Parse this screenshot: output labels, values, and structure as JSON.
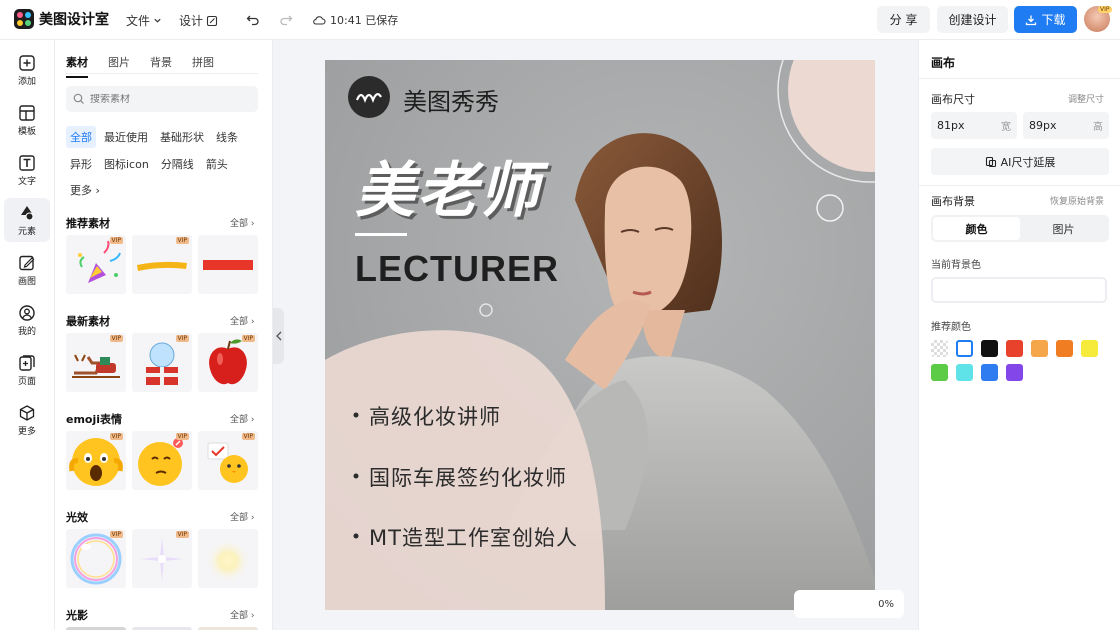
{
  "app": {
    "name": "美图设计室"
  },
  "topbar": {
    "menu_file": "文件",
    "menu_design": "设计",
    "saved_status": "10:41 已保存",
    "share_label": "分 享",
    "create_label": "创建设计",
    "download_label": "下载",
    "avatar_badge": "VIP"
  },
  "leftnav": {
    "items": [
      {
        "label": "添加",
        "icon": "plus-square-icon"
      },
      {
        "label": "模板",
        "icon": "template-icon"
      },
      {
        "label": "文字",
        "icon": "text-icon"
      },
      {
        "label": "元素",
        "icon": "shapes-icon"
      },
      {
        "label": "画图",
        "icon": "pencil-icon"
      },
      {
        "label": "我的",
        "icon": "user-icon"
      },
      {
        "label": "页面",
        "icon": "add-page-icon"
      },
      {
        "label": "更多",
        "icon": "cube-icon"
      }
    ]
  },
  "panel": {
    "tabs": [
      "素材",
      "图片",
      "背景",
      "拼图"
    ],
    "search_placeholder": "搜索素材",
    "chips_row1": [
      "全部",
      "最近使用",
      "基础形状",
      "线条"
    ],
    "chips_row2": [
      "异形",
      "图标icon",
      "分隔线",
      "箭头"
    ],
    "more_label": "更多",
    "all_label": "全部",
    "vip": "VIP",
    "sections": [
      "推荐素材",
      "最新素材",
      "emoji表情",
      "光效",
      "光影"
    ]
  },
  "canvas": {
    "brand": "美图秀秀",
    "title": "美老师",
    "subtitle": "LECTURER",
    "bullets": [
      "高级化妆讲师",
      "国际车展签约化妆师",
      "MT造型工作室创始人"
    ],
    "zoom": "0%"
  },
  "rpanel": {
    "title": "画布",
    "size_label": "画布尺寸",
    "size_adjust": "调整尺寸",
    "width_value": "81px",
    "width_unit": "宽",
    "height_value": "89px",
    "height_unit": "高",
    "ai_extend": "AI尺寸延展",
    "bg_label": "画布背景",
    "bg_reset": "恢复原始背景",
    "seg_color": "颜色",
    "seg_image": "图片",
    "current_bg": "当前背景色",
    "recommend": "推荐颜色",
    "swatches_row1": [
      "transparent",
      "#ffffff",
      "#111111",
      "#e8412c",
      "#f5a54a",
      "#f07d22",
      "#f6ea3b"
    ],
    "swatches_row2": [
      "#5ccb45",
      "#5fe3e8",
      "#2f7cf0",
      "#8347e9"
    ]
  }
}
